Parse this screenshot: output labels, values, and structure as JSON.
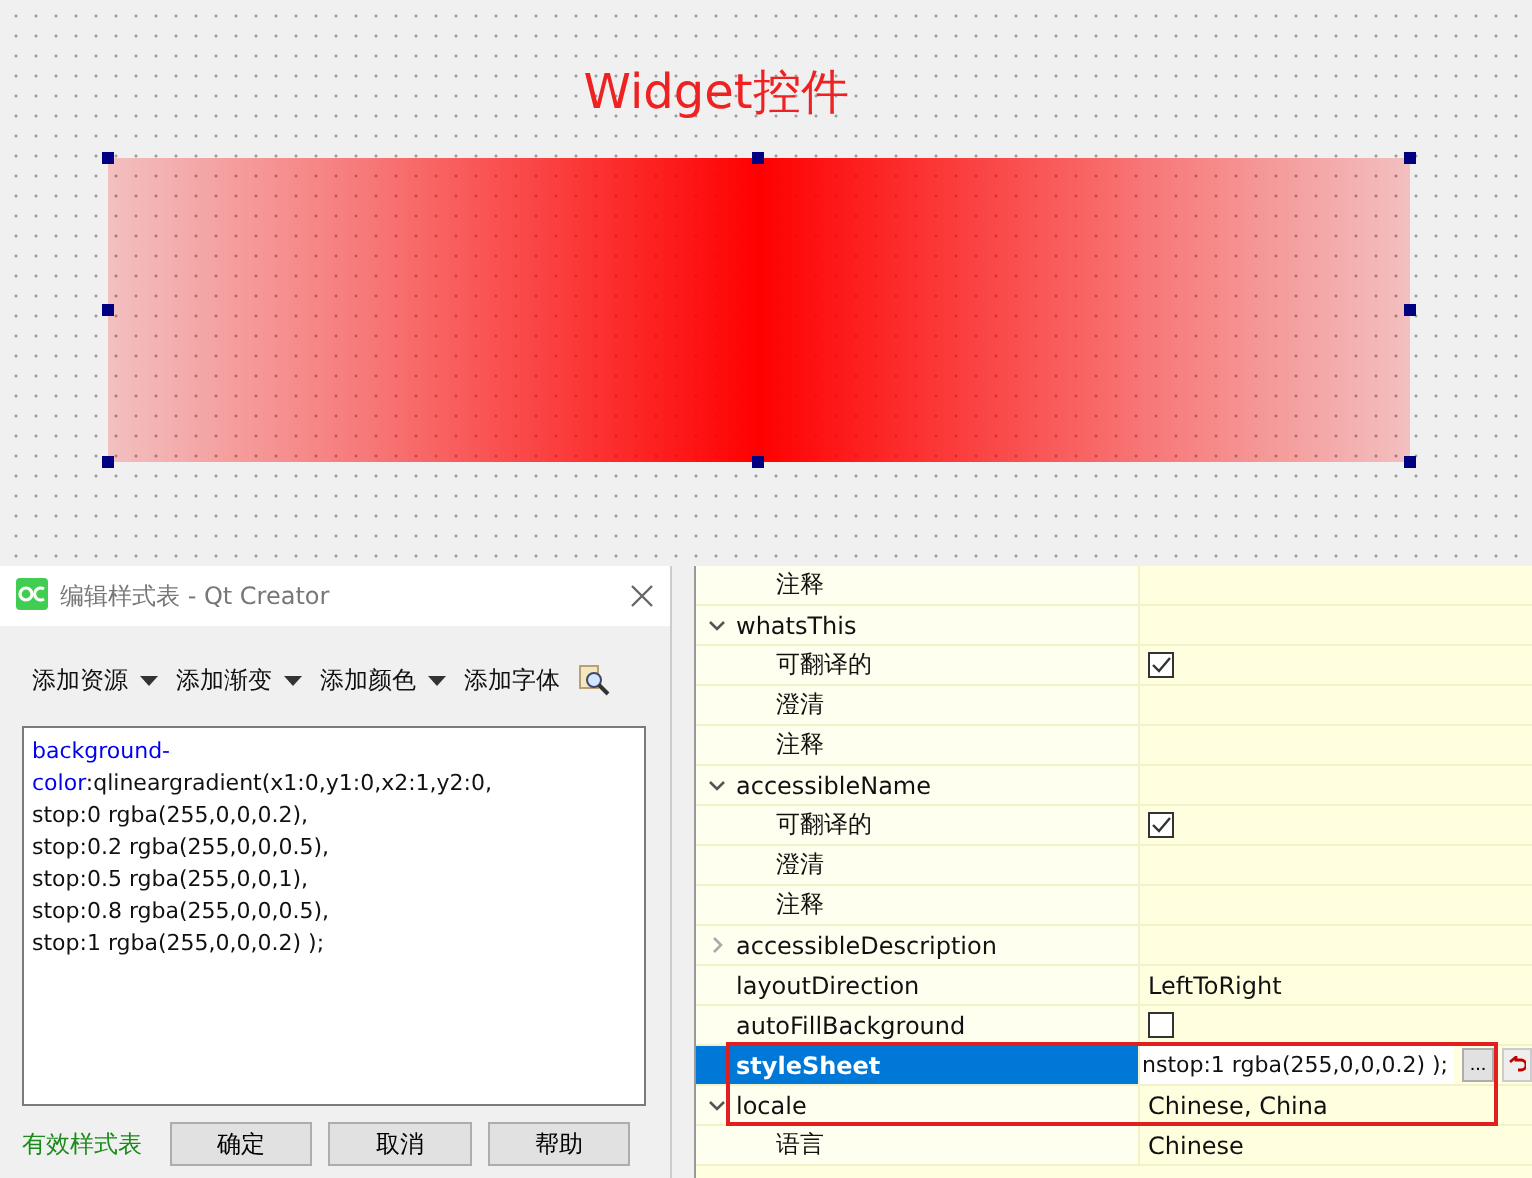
{
  "canvas": {
    "label": "Widget控件",
    "widget": {
      "selected": true
    }
  },
  "dialog": {
    "title": "编辑样式表 - Qt Creator",
    "toolbar": [
      {
        "label": "添加资源",
        "kind": "menu"
      },
      {
        "label": "添加渐变",
        "kind": "menu"
      },
      {
        "label": "添加颜色",
        "kind": "menu"
      },
      {
        "label": "添加字体",
        "kind": "plain"
      }
    ],
    "editor_lines": [
      [
        {
          "text": "background-",
          "kind": "property"
        }
      ],
      [
        {
          "text": "color",
          "kind": "property"
        },
        {
          "text": ":qlineargradient(x1:0,y1:0,x2:1,y2:0,",
          "kind": "value"
        }
      ],
      [
        {
          "text": "stop:0 rgba(255,0,0,0.2),",
          "kind": "value"
        }
      ],
      [
        {
          "text": "stop:0.2 rgba(255,0,0,0.5),",
          "kind": "value"
        }
      ],
      [
        {
          "text": "stop:0.5 rgba(255,0,0,1),",
          "kind": "value"
        }
      ],
      [
        {
          "text": "stop:0.8 rgba(255,0,0,0.5),",
          "kind": "value"
        }
      ],
      [
        {
          "text": "stop:1 rgba(255,0,0,0.2) );",
          "kind": "value"
        }
      ]
    ],
    "status": "有效样式表",
    "buttons": [
      "确定",
      "取消",
      "帮助"
    ]
  },
  "properties": [
    {
      "kind": "continuation",
      "children": [
        {
          "name": "注释",
          "kind": "text"
        }
      ]
    },
    {
      "name": "whatsThis",
      "kind": "group",
      "expanded": true,
      "children": [
        {
          "name": "可翻译的",
          "kind": "check",
          "checked": true
        },
        {
          "name": "澄清",
          "kind": "text"
        },
        {
          "name": "注释",
          "kind": "text"
        }
      ]
    },
    {
      "name": "accessibleName",
      "kind": "group",
      "expanded": true,
      "children": [
        {
          "name": "可翻译的",
          "kind": "check",
          "checked": true
        },
        {
          "name": "澄清",
          "kind": "text"
        },
        {
          "name": "注释",
          "kind": "text"
        }
      ]
    },
    {
      "name": "accessibleDescription",
      "kind": "group",
      "expanded": false
    },
    {
      "name": "layoutDirection",
      "kind": "text",
      "value": "LeftToRight"
    },
    {
      "name": "autoFillBackground",
      "kind": "check",
      "checked": false
    },
    {
      "name": "styleSheet",
      "kind": "editor",
      "value": "nstop:1 rgba(255,0,0,0.2) );",
      "selected": true
    },
    {
      "name": "locale",
      "kind": "group",
      "expanded": true,
      "value": "Chinese, China",
      "children": [
        {
          "name": "语言",
          "kind": "text",
          "value": "Chinese"
        }
      ]
    }
  ],
  "browse_label": "..."
}
